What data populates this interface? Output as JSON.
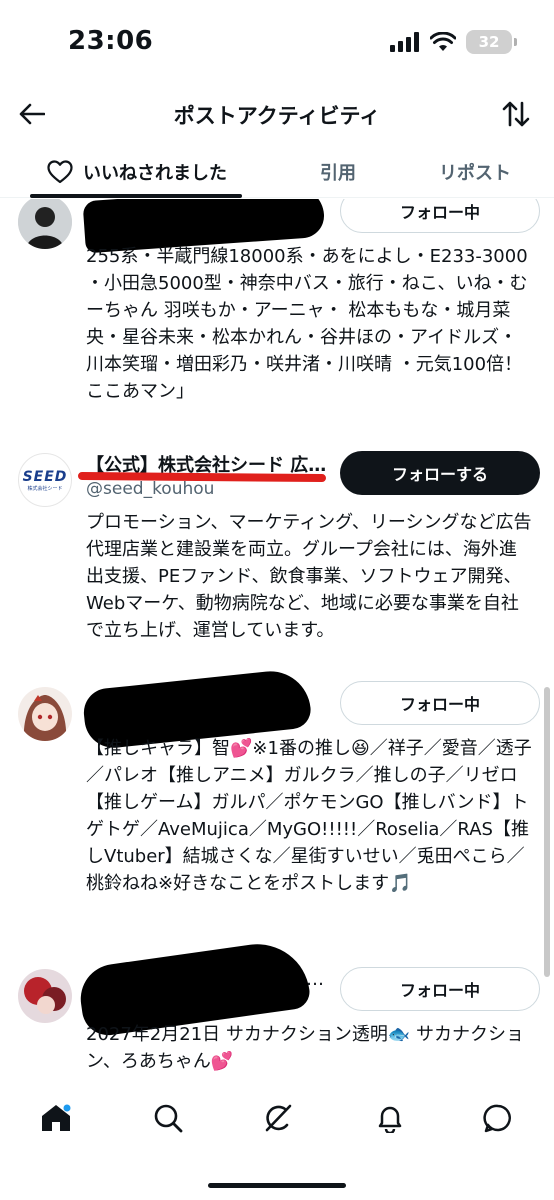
{
  "status_bar": {
    "time": "23:06",
    "battery": "32"
  },
  "header": {
    "title": "ポストアクティビティ"
  },
  "tabs": [
    {
      "label": "いいねされました"
    },
    {
      "label": "引用"
    },
    {
      "label": "リポスト"
    }
  ],
  "users": [
    {
      "name": "",
      "handle": "",
      "button": "フォロー中",
      "bio": "255系・半蔵門線18000系・あをによし・E233-3000 ・小田急5000型・神奈中バス・旅行・ねこ、いね・むーちゃん 羽咲もか・アーニャ・ 松本ももな・城月菜央・星谷未来・松本かれん・谷井ほの・アイドルズ・川本笑瑠・増田彩乃・咲井渚・川咲晴 ・元気100倍！ここあマン」"
    },
    {
      "name": "【公式】株式会社シード 広…",
      "handle": "@seed_kouhou",
      "avatar_text": "SEED",
      "avatar_sub": "株式会社シード",
      "button": "フォローする",
      "bio": "プロモーション、マーケティング、リーシングなど広告代理店業と建設業を両立。グループ会社には、海外進出支援、PEファンド、飲食事業、ソフトウェア開発、Webマーケ、動物病院など、地域に必要な事業を自社で立ち上げ、運営しています。"
    },
    {
      "name": "",
      "handle": "",
      "button": "フォロー中",
      "bio": "【推しキャラ】智💕※1番の推し😆／祥子／愛音／透子／パレオ【推しアニメ】ガルクラ／推しの子／リゼロ【推しゲーム】ガルパ／ポケモンGO【推しバンド】トゲトゲ／AveMujica／MyGO!!!!!／Roselia／RAS【推しVtuber】結城さくな／星街すいせい／兎田ぺこら／桃鈴ねね※好きなことをポストします🎵"
    },
    {
      "name": "…",
      "handle": "",
      "button": "フォロー中",
      "bio": "2027年2月21日 サカナクション透明🐟 サカナクション、ろあちゃん💕"
    }
  ],
  "nav": [
    "home-icon",
    "search-icon",
    "grok-icon",
    "notifications-icon",
    "messages-icon"
  ],
  "colors": {
    "accent": "#0f1419",
    "muted": "#536471",
    "border": "#cfd9de",
    "redline": "#e0201c"
  }
}
